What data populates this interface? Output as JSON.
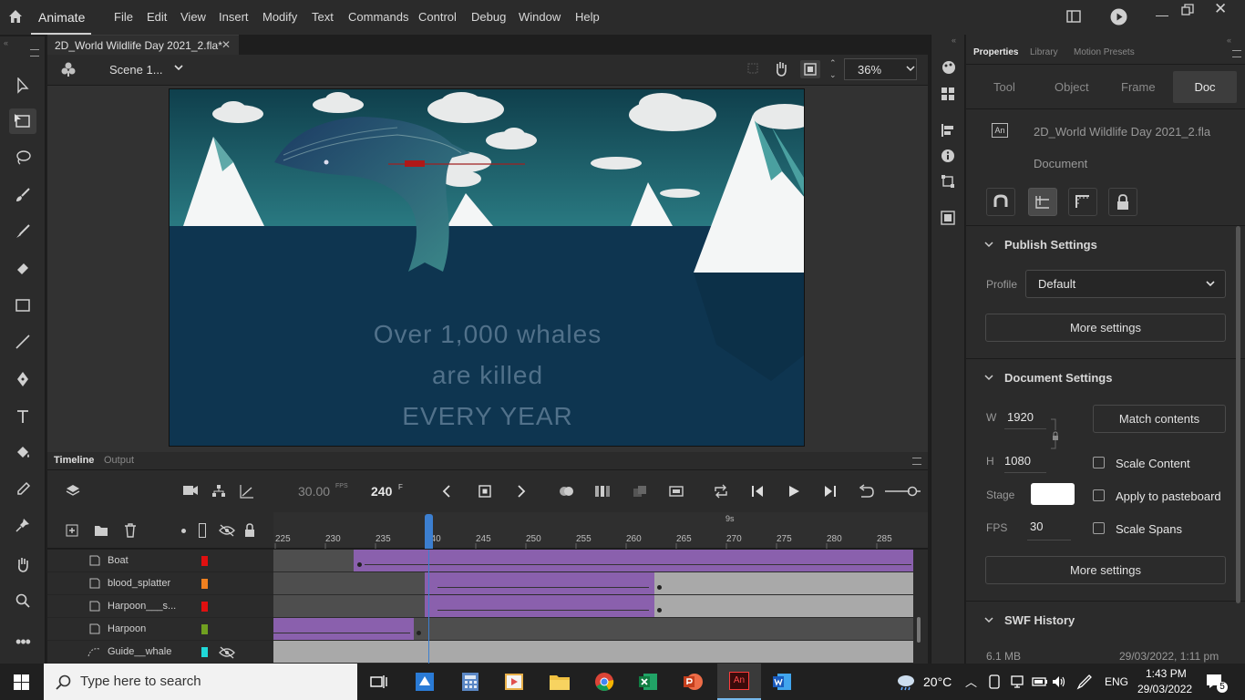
{
  "app": {
    "name": "Animate"
  },
  "menu": [
    "File",
    "Edit",
    "View",
    "Insert",
    "Modify",
    "Text",
    "Commands",
    "Control",
    "Debug",
    "Window",
    "Help"
  ],
  "document": {
    "tab_title": "2D_World Wildlife Day 2021_2.fla*",
    "scene": "Scene 1...",
    "zoom": "36%"
  },
  "stage": {
    "line1": "Over 1,000 whales",
    "line2": "are killed",
    "line3": "EVERY YEAR",
    "sky_color": "#1d5f6e",
    "sea_color": "#0e3550"
  },
  "timeline": {
    "tabs": [
      "Timeline",
      "Output"
    ],
    "fps": "30.00",
    "fps_unit": "FPS",
    "current_frame": "240",
    "frame_unit": "F",
    "ruler_ticks": [
      "225",
      "230",
      "235",
      "240",
      "245",
      "250",
      "255",
      "260",
      "265",
      "270",
      "275",
      "280",
      "285"
    ],
    "seconds_marker": "9s",
    "playhead_frame": 240,
    "layers": [
      {
        "name": "Boat",
        "color": "#e01010"
      },
      {
        "name": "blood_splatter",
        "color": "#f08020"
      },
      {
        "name": "Harpoon___s...",
        "color": "#e01010"
      },
      {
        "name": "Harpoon",
        "color": "#70a020"
      },
      {
        "name": "Guide__whale",
        "color": "#20d8d8"
      }
    ]
  },
  "properties": {
    "tabs": [
      "Properties",
      "Library",
      "Motion Presets"
    ],
    "subtabs": [
      "Tool",
      "Object",
      "Frame",
      "Doc"
    ],
    "doc_name": "2D_World Wildlife Day 2021_2.fla",
    "doc_type": "Document",
    "publish": {
      "title": "Publish Settings",
      "profile_label": "Profile",
      "profile_value": "Default",
      "more_settings": "More settings"
    },
    "docsettings": {
      "title": "Document Settings",
      "w_label": "W",
      "w_value": "1920",
      "h_label": "H",
      "h_value": "1080",
      "match_contents": "Match contents",
      "scale_content": "Scale Content",
      "stage_label": "Stage",
      "stage_color": "#ffffff",
      "apply_pasteboard": "Apply to pasteboard",
      "fps_label": "FPS",
      "fps_value": "30",
      "scale_spans": "Scale Spans",
      "more_settings": "More settings"
    },
    "swf": {
      "title": "SWF History",
      "size": "6.1 MB",
      "date": "29/03/2022, 1:11 pm"
    }
  },
  "taskbar": {
    "search_placeholder": "Type here to search",
    "weather": "20°C",
    "language": "ENG",
    "time": "1:43 PM",
    "date": "29/03/2022",
    "notifications": "5"
  }
}
